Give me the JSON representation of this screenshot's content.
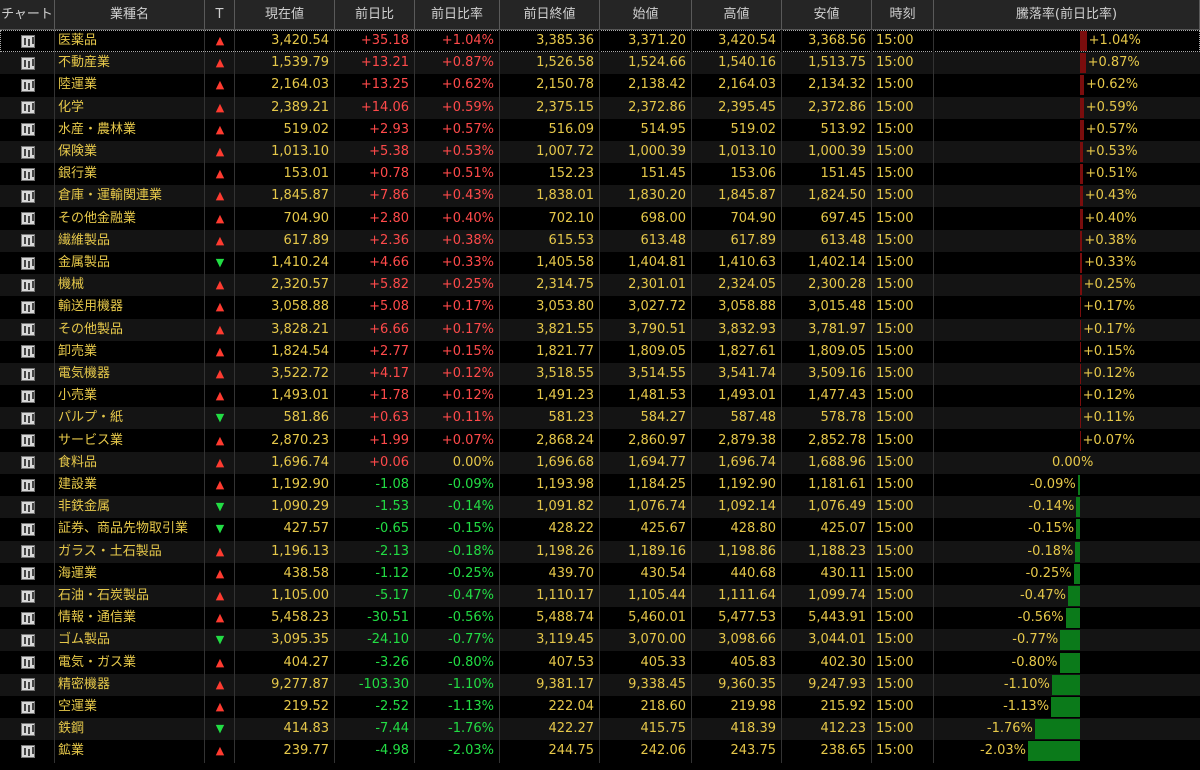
{
  "columns": [
    "チャート",
    "業種名",
    "T",
    "現在値",
    "前日比",
    "前日比率",
    "前日終値",
    "始値",
    "高値",
    "安値",
    "時刻",
    "騰落率(前日比率)"
  ],
  "colors": {
    "up": "#ff4a4a",
    "down": "#22dd44",
    "bar_up": "#7a0d0d",
    "bar_down": "#0b7a1a",
    "text": "#e6c84a"
  },
  "rows": [
    {
      "name": "医薬品",
      "trend": "up",
      "price": "3,420.54",
      "change": "+35.18",
      "rate": "+1.04%",
      "prev_close": "3,385.36",
      "open": "3,371.20",
      "high": "3,420.54",
      "low": "3,368.56",
      "time": "15:00",
      "pct": 1.04
    },
    {
      "name": "不動産業",
      "trend": "up",
      "price": "1,539.79",
      "change": "+13.21",
      "rate": "+0.87%",
      "prev_close": "1,526.58",
      "open": "1,524.66",
      "high": "1,540.16",
      "low": "1,513.75",
      "time": "15:00",
      "pct": 0.87
    },
    {
      "name": "陸運業",
      "trend": "up",
      "price": "2,164.03",
      "change": "+13.25",
      "rate": "+0.62%",
      "prev_close": "2,150.78",
      "open": "2,138.42",
      "high": "2,164.03",
      "low": "2,134.32",
      "time": "15:00",
      "pct": 0.62
    },
    {
      "name": "化学",
      "trend": "up",
      "price": "2,389.21",
      "change": "+14.06",
      "rate": "+0.59%",
      "prev_close": "2,375.15",
      "open": "2,372.86",
      "high": "2,395.45",
      "low": "2,372.86",
      "time": "15:00",
      "pct": 0.59
    },
    {
      "name": "水産・農林業",
      "trend": "up",
      "price": "519.02",
      "change": "+2.93",
      "rate": "+0.57%",
      "prev_close": "516.09",
      "open": "514.95",
      "high": "519.02",
      "low": "513.92",
      "time": "15:00",
      "pct": 0.57
    },
    {
      "name": "保険業",
      "trend": "up",
      "price": "1,013.10",
      "change": "+5.38",
      "rate": "+0.53%",
      "prev_close": "1,007.72",
      "open": "1,000.39",
      "high": "1,013.10",
      "low": "1,000.39",
      "time": "15:00",
      "pct": 0.53
    },
    {
      "name": "銀行業",
      "trend": "up",
      "price": "153.01",
      "change": "+0.78",
      "rate": "+0.51%",
      "prev_close": "152.23",
      "open": "151.45",
      "high": "153.06",
      "low": "151.45",
      "time": "15:00",
      "pct": 0.51
    },
    {
      "name": "倉庫・運輸関連業",
      "trend": "up",
      "price": "1,845.87",
      "change": "+7.86",
      "rate": "+0.43%",
      "prev_close": "1,838.01",
      "open": "1,830.20",
      "high": "1,845.87",
      "low": "1,824.50",
      "time": "15:00",
      "pct": 0.43
    },
    {
      "name": "その他金融業",
      "trend": "up",
      "price": "704.90",
      "change": "+2.80",
      "rate": "+0.40%",
      "prev_close": "702.10",
      "open": "698.00",
      "high": "704.90",
      "low": "697.45",
      "time": "15:00",
      "pct": 0.4
    },
    {
      "name": "繊維製品",
      "trend": "up",
      "price": "617.89",
      "change": "+2.36",
      "rate": "+0.38%",
      "prev_close": "615.53",
      "open": "613.48",
      "high": "617.89",
      "low": "613.48",
      "time": "15:00",
      "pct": 0.38
    },
    {
      "name": "金属製品",
      "trend": "down",
      "price": "1,410.24",
      "change": "+4.66",
      "rate": "+0.33%",
      "prev_close": "1,405.58",
      "open": "1,404.81",
      "high": "1,410.63",
      "low": "1,402.14",
      "time": "15:00",
      "pct": 0.33
    },
    {
      "name": "機械",
      "trend": "up",
      "price": "2,320.57",
      "change": "+5.82",
      "rate": "+0.25%",
      "prev_close": "2,314.75",
      "open": "2,301.01",
      "high": "2,324.05",
      "low": "2,300.28",
      "time": "15:00",
      "pct": 0.25
    },
    {
      "name": "輸送用機器",
      "trend": "up",
      "price": "3,058.88",
      "change": "+5.08",
      "rate": "+0.17%",
      "prev_close": "3,053.80",
      "open": "3,027.72",
      "high": "3,058.88",
      "low": "3,015.48",
      "time": "15:00",
      "pct": 0.17
    },
    {
      "name": "その他製品",
      "trend": "up",
      "price": "3,828.21",
      "change": "+6.66",
      "rate": "+0.17%",
      "prev_close": "3,821.55",
      "open": "3,790.51",
      "high": "3,832.93",
      "low": "3,781.97",
      "time": "15:00",
      "pct": 0.17
    },
    {
      "name": "卸売業",
      "trend": "up",
      "price": "1,824.54",
      "change": "+2.77",
      "rate": "+0.15%",
      "prev_close": "1,821.77",
      "open": "1,809.05",
      "high": "1,827.61",
      "low": "1,809.05",
      "time": "15:00",
      "pct": 0.15
    },
    {
      "name": "電気機器",
      "trend": "up",
      "price": "3,522.72",
      "change": "+4.17",
      "rate": "+0.12%",
      "prev_close": "3,518.55",
      "open": "3,514.55",
      "high": "3,541.74",
      "low": "3,509.16",
      "time": "15:00",
      "pct": 0.12
    },
    {
      "name": "小売業",
      "trend": "up",
      "price": "1,493.01",
      "change": "+1.78",
      "rate": "+0.12%",
      "prev_close": "1,491.23",
      "open": "1,481.53",
      "high": "1,493.01",
      "low": "1,477.43",
      "time": "15:00",
      "pct": 0.12
    },
    {
      "name": "パルプ・紙",
      "trend": "down",
      "price": "581.86",
      "change": "+0.63",
      "rate": "+0.11%",
      "prev_close": "581.23",
      "open": "584.27",
      "high": "587.48",
      "low": "578.78",
      "time": "15:00",
      "pct": 0.11
    },
    {
      "name": "サービス業",
      "trend": "up",
      "price": "2,870.23",
      "change": "+1.99",
      "rate": "+0.07%",
      "prev_close": "2,868.24",
      "open": "2,860.97",
      "high": "2,879.38",
      "low": "2,852.78",
      "time": "15:00",
      "pct": 0.07
    },
    {
      "name": "食料品",
      "trend": "up",
      "price": "1,696.74",
      "change": "+0.06",
      "rate": "0.00%",
      "prev_close": "1,696.68",
      "open": "1,694.77",
      "high": "1,696.74",
      "low": "1,688.96",
      "time": "15:00",
      "pct": 0.0
    },
    {
      "name": "建設業",
      "trend": "up",
      "price": "1,192.90",
      "change": "-1.08",
      "rate": "-0.09%",
      "prev_close": "1,193.98",
      "open": "1,184.25",
      "high": "1,192.90",
      "low": "1,181.61",
      "time": "15:00",
      "pct": -0.09
    },
    {
      "name": "非鉄金属",
      "trend": "down",
      "price": "1,090.29",
      "change": "-1.53",
      "rate": "-0.14%",
      "prev_close": "1,091.82",
      "open": "1,076.74",
      "high": "1,092.14",
      "low": "1,076.49",
      "time": "15:00",
      "pct": -0.14
    },
    {
      "name": "証券、商品先物取引業",
      "trend": "down",
      "price": "427.57",
      "change": "-0.65",
      "rate": "-0.15%",
      "prev_close": "428.22",
      "open": "425.67",
      "high": "428.80",
      "low": "425.07",
      "time": "15:00",
      "pct": -0.15
    },
    {
      "name": "ガラス・土石製品",
      "trend": "up",
      "price": "1,196.13",
      "change": "-2.13",
      "rate": "-0.18%",
      "prev_close": "1,198.26",
      "open": "1,189.16",
      "high": "1,198.86",
      "low": "1,188.23",
      "time": "15:00",
      "pct": -0.18
    },
    {
      "name": "海運業",
      "trend": "up",
      "price": "438.58",
      "change": "-1.12",
      "rate": "-0.25%",
      "prev_close": "439.70",
      "open": "430.54",
      "high": "440.68",
      "low": "430.11",
      "time": "15:00",
      "pct": -0.25
    },
    {
      "name": "石油・石炭製品",
      "trend": "up",
      "price": "1,105.00",
      "change": "-5.17",
      "rate": "-0.47%",
      "prev_close": "1,110.17",
      "open": "1,105.44",
      "high": "1,111.64",
      "low": "1,099.74",
      "time": "15:00",
      "pct": -0.47
    },
    {
      "name": "情報・通信業",
      "trend": "up",
      "price": "5,458.23",
      "change": "-30.51",
      "rate": "-0.56%",
      "prev_close": "5,488.74",
      "open": "5,460.01",
      "high": "5,477.53",
      "low": "5,443.91",
      "time": "15:00",
      "pct": -0.56
    },
    {
      "name": "ゴム製品",
      "trend": "down",
      "price": "3,095.35",
      "change": "-24.10",
      "rate": "-0.77%",
      "prev_close": "3,119.45",
      "open": "3,070.00",
      "high": "3,098.66",
      "low": "3,044.01",
      "time": "15:00",
      "pct": -0.77
    },
    {
      "name": "電気・ガス業",
      "trend": "up",
      "price": "404.27",
      "change": "-3.26",
      "rate": "-0.80%",
      "prev_close": "407.53",
      "open": "405.33",
      "high": "405.83",
      "low": "402.30",
      "time": "15:00",
      "pct": -0.8
    },
    {
      "name": "精密機器",
      "trend": "up",
      "price": "9,277.87",
      "change": "-103.30",
      "rate": "-1.10%",
      "prev_close": "9,381.17",
      "open": "9,338.45",
      "high": "9,360.35",
      "low": "9,247.93",
      "time": "15:00",
      "pct": -1.1
    },
    {
      "name": "空運業",
      "trend": "up",
      "price": "219.52",
      "change": "-2.52",
      "rate": "-1.13%",
      "prev_close": "222.04",
      "open": "218.60",
      "high": "219.98",
      "low": "215.92",
      "time": "15:00",
      "pct": -1.13
    },
    {
      "name": "鉄鋼",
      "trend": "down",
      "price": "414.83",
      "change": "-7.44",
      "rate": "-1.76%",
      "prev_close": "422.27",
      "open": "415.75",
      "high": "418.39",
      "low": "412.23",
      "time": "15:00",
      "pct": -1.76
    },
    {
      "name": "鉱業",
      "trend": "up",
      "price": "239.77",
      "change": "-4.98",
      "rate": "-2.03%",
      "prev_close": "244.75",
      "open": "242.06",
      "high": "243.75",
      "low": "238.65",
      "time": "15:00",
      "pct": -2.03
    }
  ]
}
